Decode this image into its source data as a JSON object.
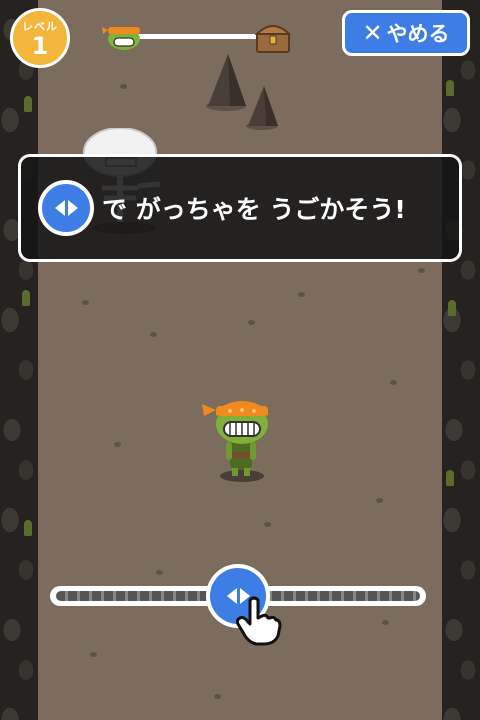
{
  "hud": {
    "level_label": "レベル",
    "level_number": "1",
    "progress_fraction": 0.0,
    "quit_icon": "close-icon",
    "quit_label": "やめる"
  },
  "tutorial": {
    "icon": "left-right-arrows-icon",
    "text": "で がっちゃを うごかそう!"
  },
  "controls": {
    "slider_icon": "left-right-arrows-icon",
    "slider_position": 0.5,
    "pointer_icon": "pointing-hand-icon"
  },
  "colors": {
    "accent_blue": "#3f7de6",
    "level_gold": "#f3b63b",
    "ground": "#7b6c5e",
    "wall": "#25221f"
  }
}
